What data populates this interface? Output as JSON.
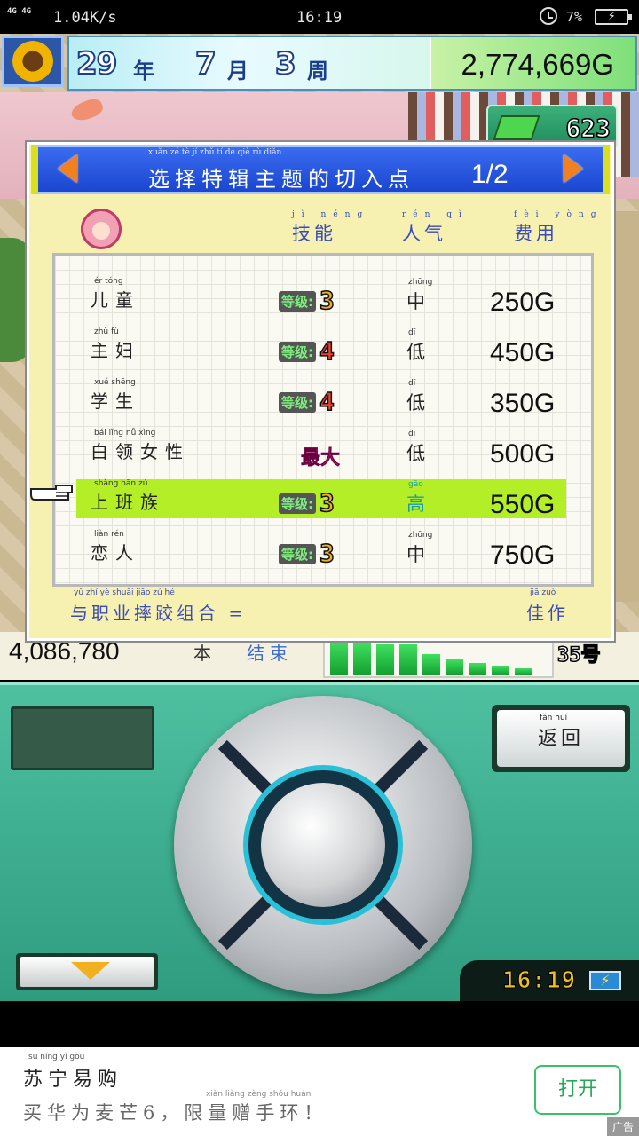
{
  "status_bar": {
    "network": "4G 4G",
    "speed": "1.04K/s",
    "time": "16:19",
    "battery_pct": "7%"
  },
  "hud": {
    "year_num": "29",
    "year_unit": "年",
    "month_num": "7",
    "month_unit": "月",
    "week_num": "3",
    "week_unit": "周",
    "money": "2,774,669G",
    "counter": "623"
  },
  "dialog": {
    "title_pinyin": "xuǎn  zé   tè   jí   zhǔ  tí   de   qiè  rù  diǎn",
    "title": "选择特辑主题的切入点",
    "page": "1/2",
    "headers": {
      "skill": "技能",
      "skill_py": "jì néng",
      "popularity": "人气",
      "popularity_py": "rén qì",
      "cost": "费用",
      "cost_py": "fèi yòng"
    },
    "level_label": "等级:",
    "rows": [
      {
        "name": "儿童",
        "name_py": "ér    tóng",
        "level": "3",
        "popularity": "中",
        "popularity_py": "zhōng",
        "cost": "250G"
      },
      {
        "name": "主妇",
        "name_py": "zhǔ    fù",
        "level": "4",
        "popularity": "低",
        "popularity_py": "dī",
        "cost": "450G"
      },
      {
        "name": "学生",
        "name_py": "xué   shēng",
        "level": "4",
        "popularity": "低",
        "popularity_py": "dī",
        "cost": "350G"
      },
      {
        "name": "白领女性",
        "name_py": "bái   lǐng   nǚ   xìng",
        "level_text": "最大",
        "popularity": "低",
        "popularity_py": "dī",
        "cost": "500G"
      },
      {
        "name": "上班族",
        "name_py": "shàng  bān   zú",
        "level": "3",
        "popularity": "高",
        "popularity_py": "gāo",
        "cost": "550G"
      },
      {
        "name": "恋人",
        "name_py": "liàn   rén",
        "level": "3",
        "popularity": "中",
        "popularity_py": "zhōng",
        "cost": "750G"
      }
    ],
    "combo_pinyin": "yǔ   zhí   yè  shuāi jiāo  zú   hé",
    "combo": "与职业摔跤组合 =",
    "combo_result": "佳作",
    "combo_result_py": "jiā   zuò"
  },
  "stats": {
    "sales": "4,086,780",
    "ben": "本",
    "end": "结束",
    "bar_levels": [
      0.82,
      0.78,
      0.74,
      0.74,
      0.5,
      0.38,
      0.28,
      0.22,
      0.16
    ],
    "week": "35号"
  },
  "console": {
    "back_label": "返回",
    "back_py": "fǎn  huí",
    "time": "16:19"
  },
  "ad": {
    "brand": "苏宁易购",
    "brand_py": "sū   níng   yì   gòu",
    "slogan": "买华为麦芒6，限量赠手环！",
    "slogan_pinyin": "xiàn  liàng  zèng  shǒu  huán",
    "open_button": "打开",
    "tag": "广告"
  },
  "colors": {
    "header_blue": "#1a46d0",
    "selected_row": "#b4ee26",
    "dialog_bg": "#f6f1b0",
    "console_green": "#3aac8c"
  }
}
